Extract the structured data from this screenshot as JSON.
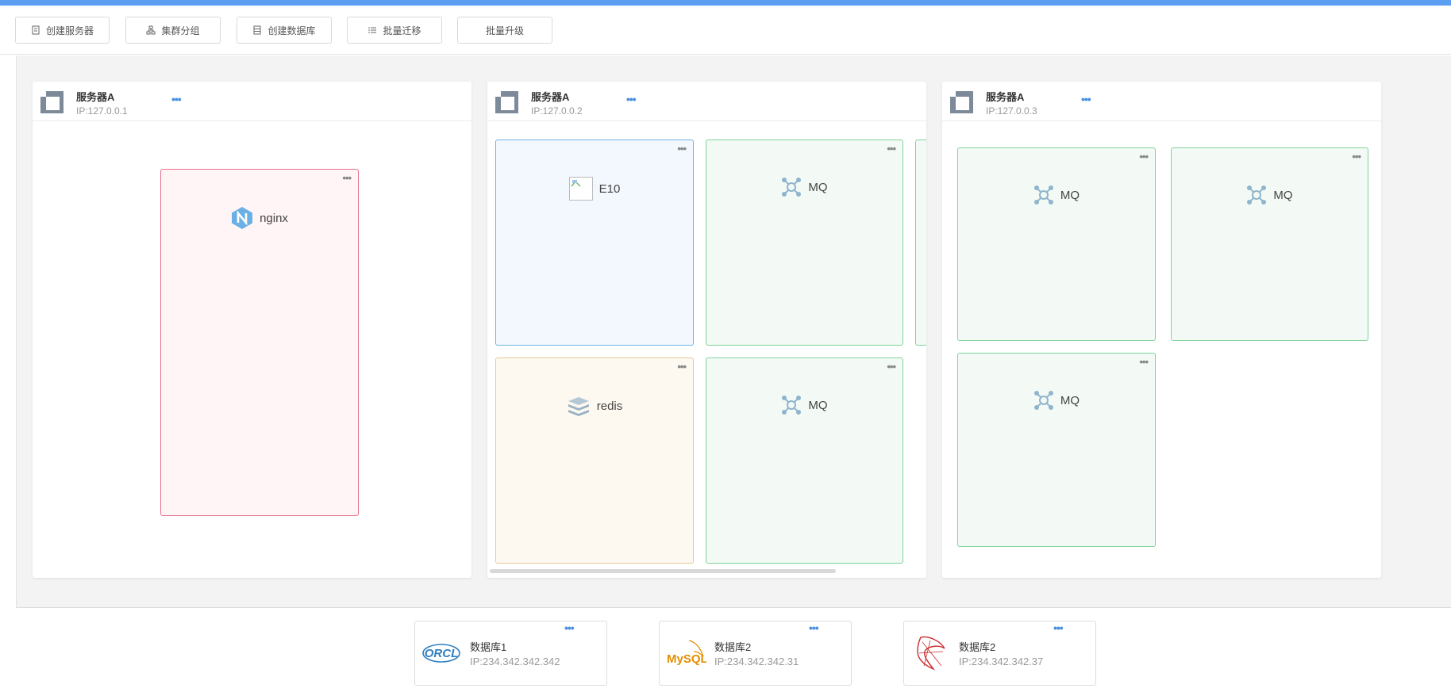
{
  "toolbar": {
    "create_server": "创建服务器",
    "cluster_group": "集群分组",
    "create_database": "创建数据库",
    "batch_migrate": "批量迁移",
    "batch_upgrade": "批量升级"
  },
  "servers": [
    {
      "name": "服务器A",
      "ip": "IP:127.0.0.1",
      "more": "•••",
      "apps": [
        {
          "label": "nginx",
          "icon": "nginx-icon",
          "more": "•••"
        }
      ]
    },
    {
      "name": "服务器A",
      "ip": "IP:127.0.0.2",
      "more": "•••",
      "apps": [
        {
          "label": "E10",
          "icon": "broken-image-icon",
          "more": "•••"
        },
        {
          "label": "MQ",
          "icon": "mq-icon",
          "more": "•••"
        },
        {
          "label": "redis",
          "icon": "redis-icon",
          "more": "•••"
        },
        {
          "label": "MQ",
          "icon": "mq-icon",
          "more": "•••"
        }
      ]
    },
    {
      "name": "服务器A",
      "ip": "IP:127.0.0.3",
      "more": "•••",
      "apps": [
        {
          "label": "MQ",
          "icon": "mq-icon",
          "more": "•••"
        },
        {
          "label": "MQ",
          "icon": "mq-icon",
          "more": "•••"
        },
        {
          "label": "MQ",
          "icon": "mq-icon",
          "more": "•••"
        }
      ]
    }
  ],
  "databases": [
    {
      "name": "数据库1",
      "ip": "IP:234.342.342.342",
      "logo": "oracle-logo",
      "logo_text": "ORCL",
      "more": "•••"
    },
    {
      "name": "数据库2",
      "ip": "IP:234.342.342.31",
      "logo": "mysql-logo",
      "logo_text": "MySQL",
      "more": "•••"
    },
    {
      "name": "数据库2",
      "ip": "IP:234.342.342.37",
      "logo": "sqlserver-logo",
      "more": "•••"
    }
  ],
  "colors": {
    "accent": "#5b9ef2",
    "nginx_card": "#e8738b",
    "e10_card": "#6eb4df",
    "mq_card": "#7ed39a",
    "redis_card": "#e7c89a"
  }
}
